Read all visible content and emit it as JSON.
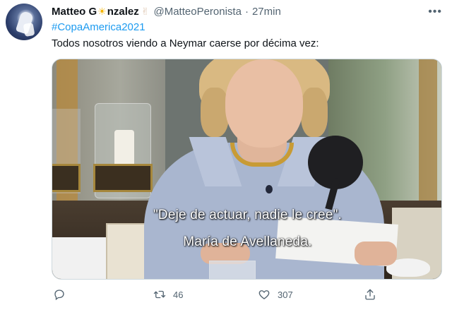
{
  "tweet": {
    "display_name_part1": "Matteo G",
    "display_name_part2": "nzalez",
    "handle": "@MatteoPeronista",
    "separator": "·",
    "time": "27min",
    "hashtag": "#CopaAmerica2021",
    "text": "Todos nosotros viendo a Neymar caerse por décima vez:"
  },
  "media": {
    "subtitle_line1": "\"Deje de actuar, nadie le cree\".",
    "subtitle_line2": "María de Avellaneda."
  },
  "actions": {
    "reply": {
      "icon": "reply-icon",
      "count": ""
    },
    "retweet": {
      "icon": "retweet-icon",
      "count": "46"
    },
    "like": {
      "icon": "heart-icon",
      "count": "307"
    },
    "share": {
      "icon": "share-icon",
      "count": ""
    }
  },
  "colors": {
    "link": "#1d9bf0",
    "secondary_text": "#536471",
    "primary_text": "#0f1419"
  }
}
